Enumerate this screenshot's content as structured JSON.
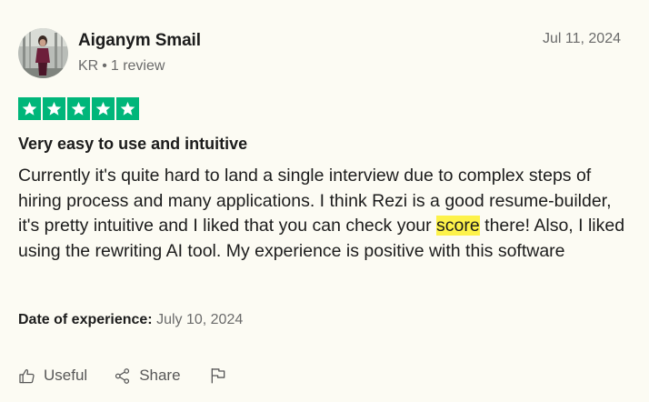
{
  "review": {
    "author": "Aiganym Smail",
    "country": "KR",
    "separator": "•",
    "review_count": "1 review",
    "date": "Jul 11, 2024",
    "rating": 5,
    "title": "Very easy to use and intuitive",
    "body_before": "Currently it's quite hard to land a single interview due to complex steps of hiring process and many applications. I think Rezi is a good resume-builder, it's pretty intuitive and I liked that you can check your ",
    "body_highlight": "score",
    "body_after": " there! Also, I liked using the rewriting AI tool. My experience is positive with this software",
    "experience_label": "Date of experience:",
    "experience_date": "July 10, 2024"
  },
  "actions": {
    "useful_label": "Useful",
    "share_label": "Share"
  },
  "colors": {
    "star_green": "#00b67a",
    "highlight": "#fdf24a",
    "background": "#fcfbf3"
  },
  "icons": [
    "thumbs-up-icon",
    "share-icon",
    "flag-icon",
    "star-icon"
  ]
}
